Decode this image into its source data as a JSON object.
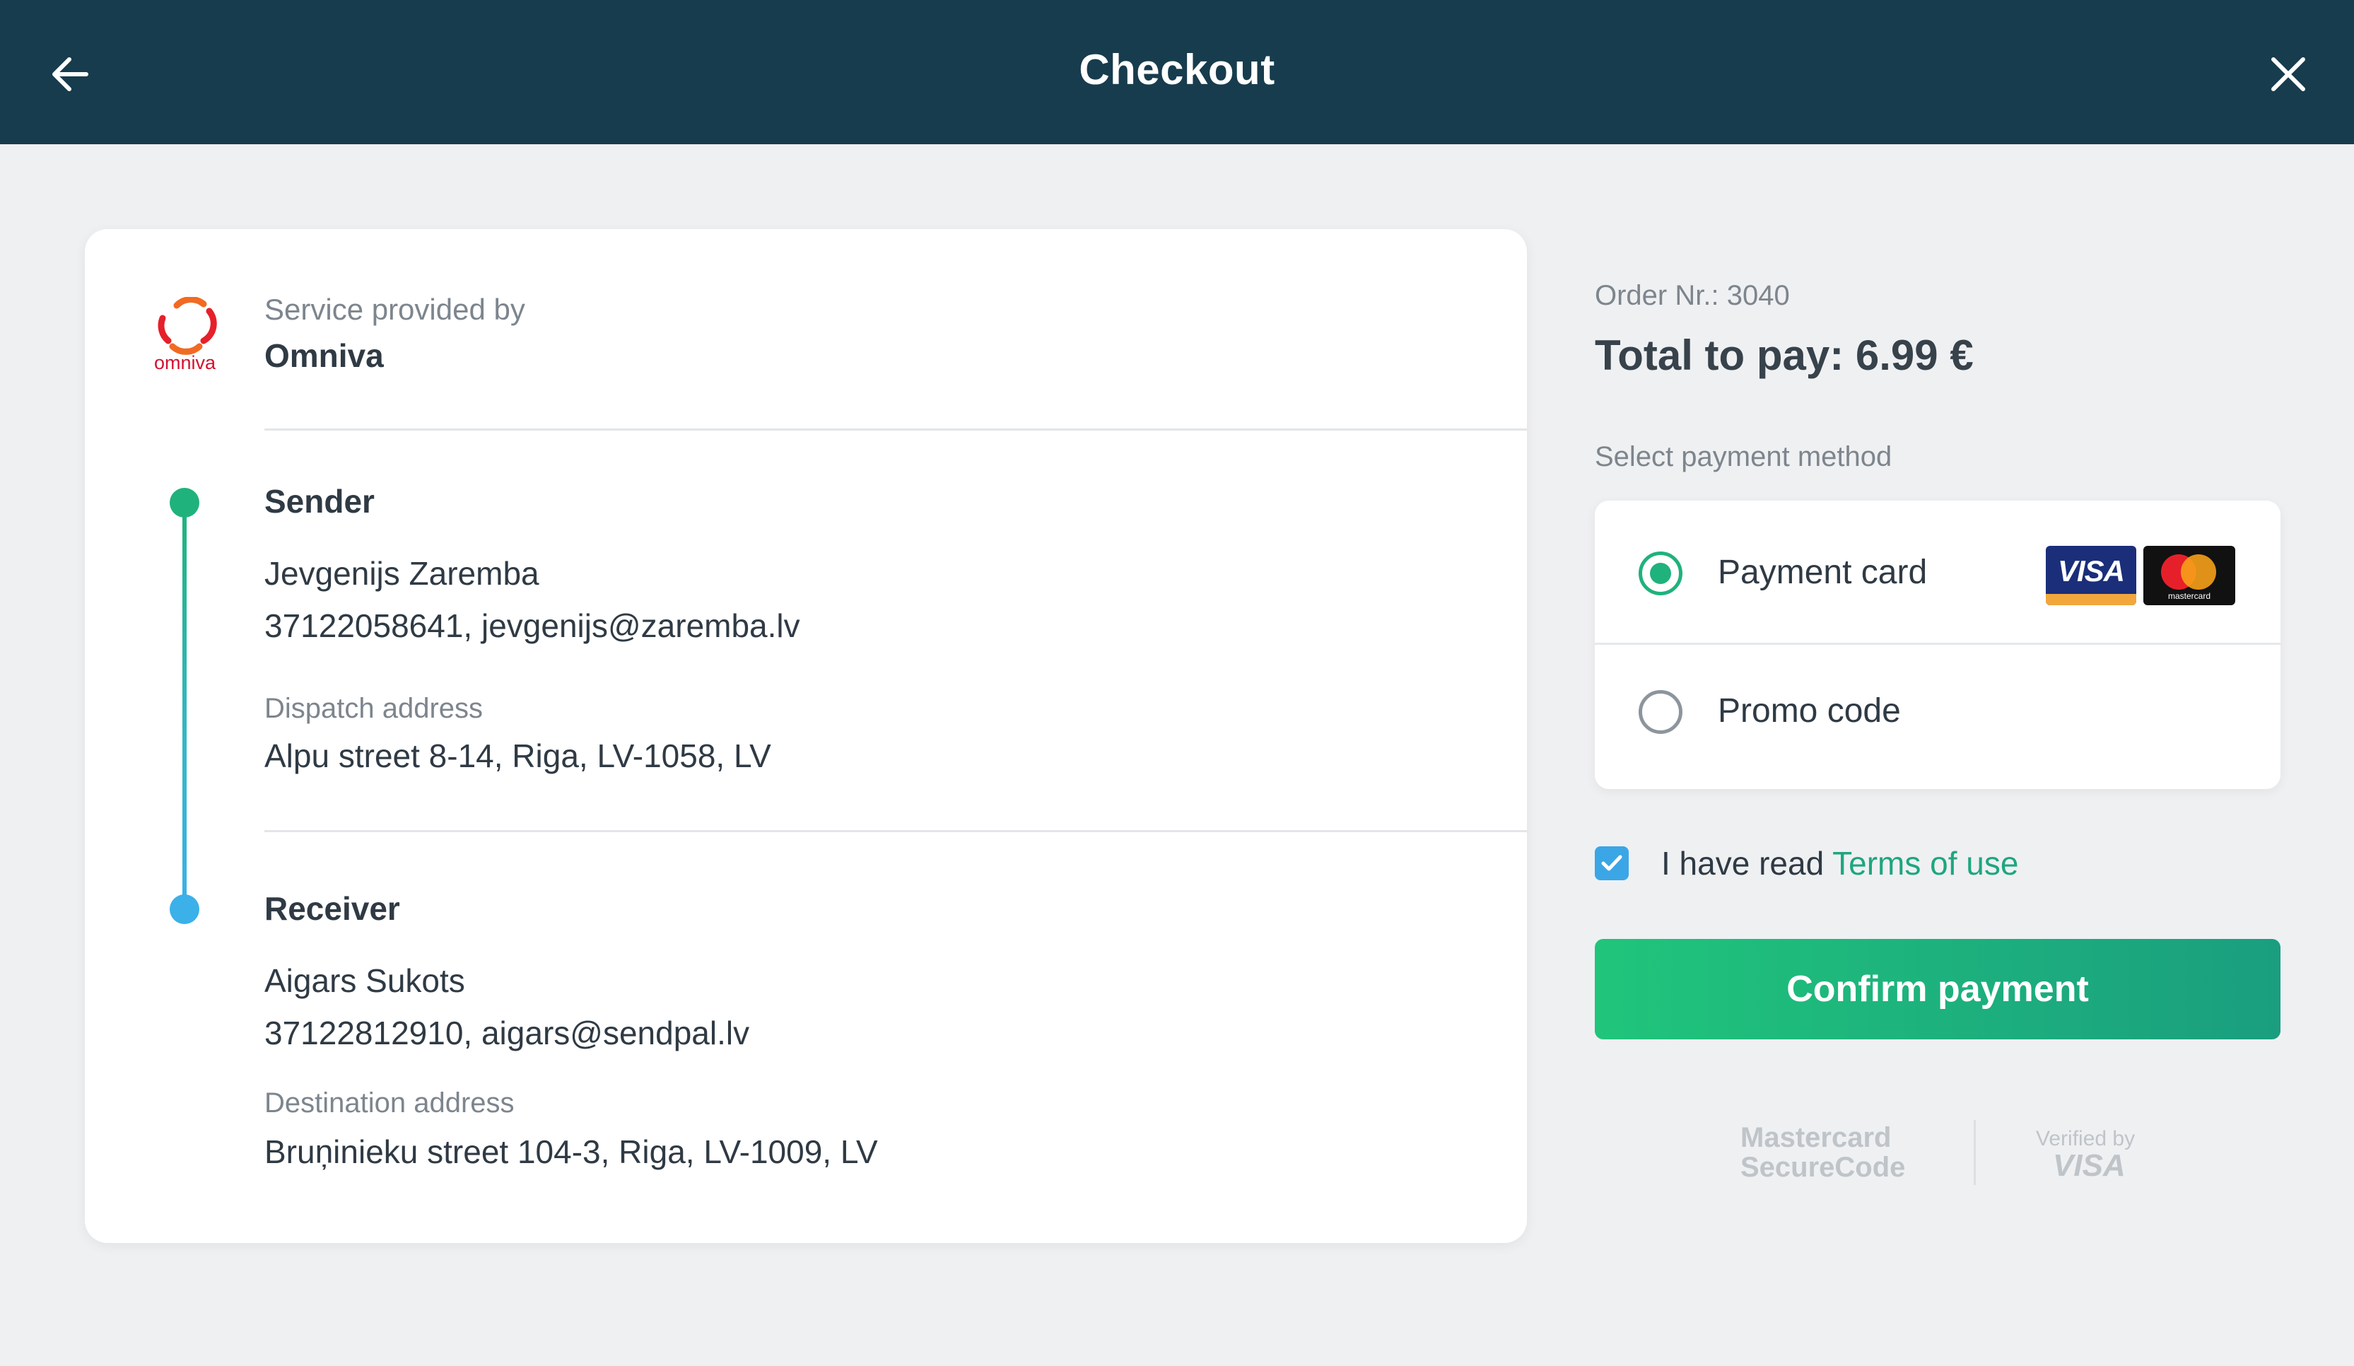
{
  "header": {
    "title": "Checkout",
    "back_icon": "arrow-left-icon",
    "close_icon": "close-icon"
  },
  "provider": {
    "label": "Service provided by",
    "name": "Omniva",
    "logo_text": "omniva"
  },
  "sender": {
    "title": "Sender",
    "name": "Jevgenijs Zaremba",
    "contact": "37122058641, jevgenijs@zaremba.lv",
    "address_label": "Dispatch address",
    "address": "Alpu street 8-14, Riga, LV-1058, LV"
  },
  "receiver": {
    "title": "Receiver",
    "name": "Aigars Sukots",
    "contact": "37122812910, aigars@sendpal.lv",
    "address_label": "Destination address",
    "address": "Bruņinieku street 104-3, Riga, LV-1009, LV"
  },
  "order": {
    "number_text": "Order Nr.: 3040",
    "total_text": "Total to pay: 6.99 €"
  },
  "payment": {
    "select_label": "Select payment method",
    "methods": [
      {
        "label": "Payment card",
        "selected": true
      },
      {
        "label": "Promo code",
        "selected": false
      }
    ],
    "visa_text": "VISA",
    "mastercard_text": "mastercard"
  },
  "terms": {
    "checked": true,
    "text": "I have read ",
    "link": "Terms of use"
  },
  "confirm_label": "Confirm payment",
  "security": {
    "mastercard_line1": "Mastercard",
    "mastercard_line2": "SecureCode",
    "visa_line1": "Verified by",
    "visa_line2": "VISA"
  },
  "colors": {
    "header_bg": "#173c4d",
    "accent_green": "#1fb27c",
    "accent_blue": "#3bb0e9",
    "page_bg": "#eff0f2"
  }
}
